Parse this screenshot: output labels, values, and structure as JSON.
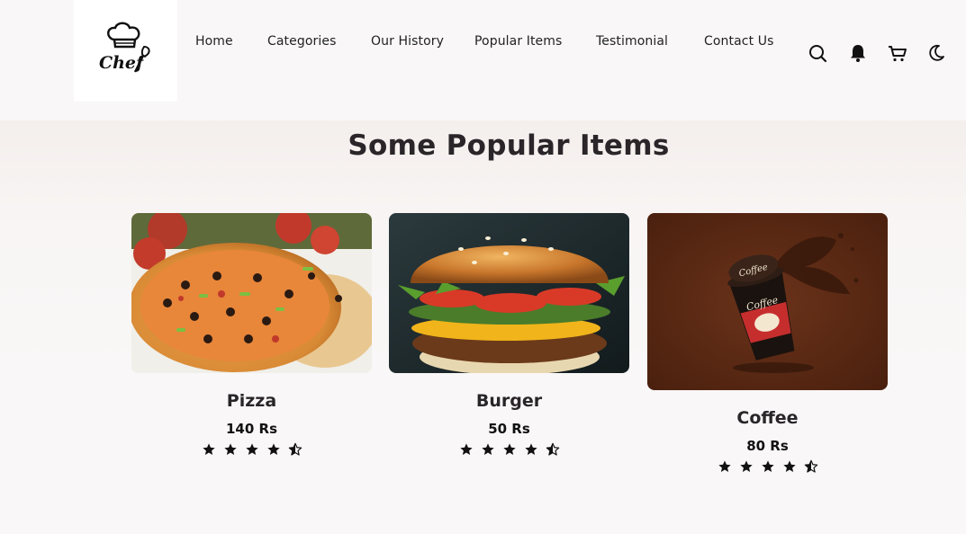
{
  "brand": {
    "logo_text": "Chef"
  },
  "nav": {
    "links": [
      "Home",
      "Categories",
      "Our History",
      "Popular Items",
      "Testimonial",
      "Contact Us"
    ]
  },
  "header_icons": [
    "search-icon",
    "bell-icon",
    "cart-icon",
    "moon-icon"
  ],
  "section": {
    "title": "Some Popular Items"
  },
  "items": [
    {
      "name": "Pizza",
      "price": "140 Rs",
      "rating": 4.5
    },
    {
      "name": "Burger",
      "price": "50 Rs",
      "rating": 4.5
    },
    {
      "name": "Coffee",
      "price": "80 Rs",
      "rating": 4.5,
      "cup_text": "Coffee"
    }
  ],
  "colors": {
    "background": "#f9f7f7",
    "text": "#2a2529",
    "coffee_bg": "#5a2a15"
  }
}
